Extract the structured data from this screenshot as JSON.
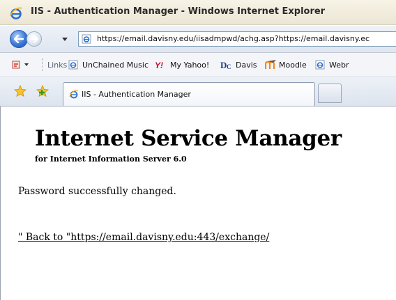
{
  "window": {
    "title": "IIS - Authentication Manager - Windows Internet Explorer"
  },
  "address_bar": {
    "url": "https://email.davisny.edu/iisadmpwd/achg.asp?https://email.davisny.ec"
  },
  "links_bar": {
    "links_label": "Links",
    "items": [
      {
        "label": "UnChained Music",
        "icon": "ie-page-icon"
      },
      {
        "label": "My Yahoo!",
        "icon": "yahoo-icon"
      },
      {
        "label": "Davis",
        "icon": "dc-logo-icon"
      },
      {
        "label": "Moodle",
        "icon": "moodle-icon"
      },
      {
        "label": "Webr",
        "icon": "ie-page-icon"
      }
    ]
  },
  "tabs": [
    {
      "label": "IIS - Authentication Manager",
      "active": true
    }
  ],
  "page": {
    "title": "Internet Service Manager",
    "subtitle": "for Internet Information Server 6.0",
    "status": "Password successfully changed.",
    "back_link": "\" Back to \"https://email.davisny.edu:443/exchange/"
  },
  "colors": {
    "ie_blue": "#2a6fd1",
    "link_text": "#000000",
    "chrome_bg": "#dfe6f1"
  }
}
